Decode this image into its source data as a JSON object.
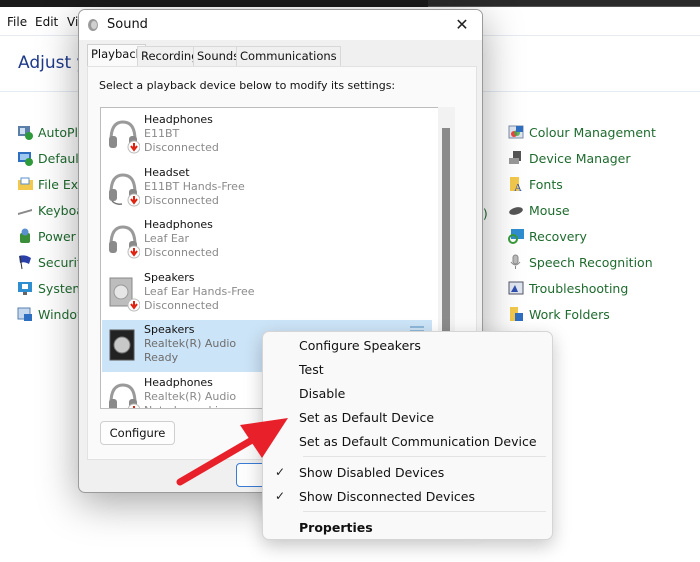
{
  "control_panel": {
    "menu": [
      "File",
      "Edit",
      "Vi"
    ],
    "heading": "Adjust y",
    "left_items": [
      {
        "label": "AutoPla",
        "icon": "autoplay-icon"
      },
      {
        "label": "Default",
        "icon": "default-programs-icon"
      },
      {
        "label": "File Exp",
        "icon": "file-explorer-icon"
      },
      {
        "label": "Keyboa",
        "icon": "keyboard-icon"
      },
      {
        "label": "Power C",
        "icon": "power-options-icon"
      },
      {
        "label": "Security",
        "icon": "security-flag-icon"
      },
      {
        "label": "System",
        "icon": "system-icon"
      },
      {
        "label": "Window",
        "icon": "windows-tools-icon"
      }
    ],
    "right_items": [
      {
        "label": "Colour Management",
        "icon": "colour-management-icon"
      },
      {
        "label": "Device Manager",
        "icon": "device-manager-icon"
      },
      {
        "label": "Fonts",
        "icon": "fonts-icon"
      },
      {
        "label": "Mouse",
        "icon": "mouse-icon"
      },
      {
        "label": "Recovery",
        "icon": "recovery-icon"
      },
      {
        "label": "Speech Recognition",
        "icon": "microphone-icon"
      },
      {
        "label": "Troubleshooting",
        "icon": "troubleshooting-icon"
      },
      {
        "label": "Work Folders",
        "icon": "work-folders-icon"
      }
    ],
    "clipped_fragment": "t)"
  },
  "sound_dialog": {
    "title": "Sound",
    "close_glyph": "✕",
    "tabs": [
      "Playback",
      "Recording",
      "Sounds",
      "Communications"
    ],
    "active_tab": "Playback",
    "instruction": "Select a playback device below to modify its settings:",
    "devices": [
      {
        "name": "Headphones",
        "detail": "E11BT",
        "status": "Disconnected",
        "type": "headphones",
        "selected": false
      },
      {
        "name": "Headset",
        "detail": "E11BT Hands-Free",
        "status": "Disconnected",
        "type": "headset",
        "selected": false
      },
      {
        "name": "Headphones",
        "detail": "Leaf Ear",
        "status": "Disconnected",
        "type": "headphones",
        "selected": false
      },
      {
        "name": "Speakers",
        "detail": "Leaf Ear Hands-Free",
        "status": "Disconnected",
        "type": "speakers-grey",
        "selected": false
      },
      {
        "name": "Speakers",
        "detail": "Realtek(R) Audio",
        "status": "Ready",
        "type": "speakers",
        "selected": true
      },
      {
        "name": "Headphones",
        "detail": "Realtek(R) Audio",
        "status": "Not plugged in",
        "type": "headphones",
        "selected": false
      }
    ],
    "configure_label": "Configure"
  },
  "context_menu": {
    "items": [
      {
        "label": "Configure Speakers",
        "checked": false,
        "bold": false
      },
      {
        "label": "Test",
        "checked": false,
        "bold": false
      },
      {
        "label": "Disable",
        "checked": false,
        "bold": false
      },
      {
        "label": "Set as Default Device",
        "checked": false,
        "bold": false
      },
      {
        "label": "Set as Default Communication Device",
        "checked": false,
        "bold": false
      },
      {
        "label": "Show Disabled Devices",
        "checked": true,
        "bold": false
      },
      {
        "label": "Show Disconnected Devices",
        "checked": true,
        "bold": false
      },
      {
        "label": "Properties",
        "checked": false,
        "bold": true
      }
    ],
    "check_glyph": "✓"
  },
  "annotation": {
    "arrow_color": "#e8202a",
    "points_to": "Set as Default Device"
  },
  "colors": {
    "link_green": "#1f6b2f",
    "heading_blue": "#1e3a8a",
    "selection_blue": "#cce4f7"
  }
}
